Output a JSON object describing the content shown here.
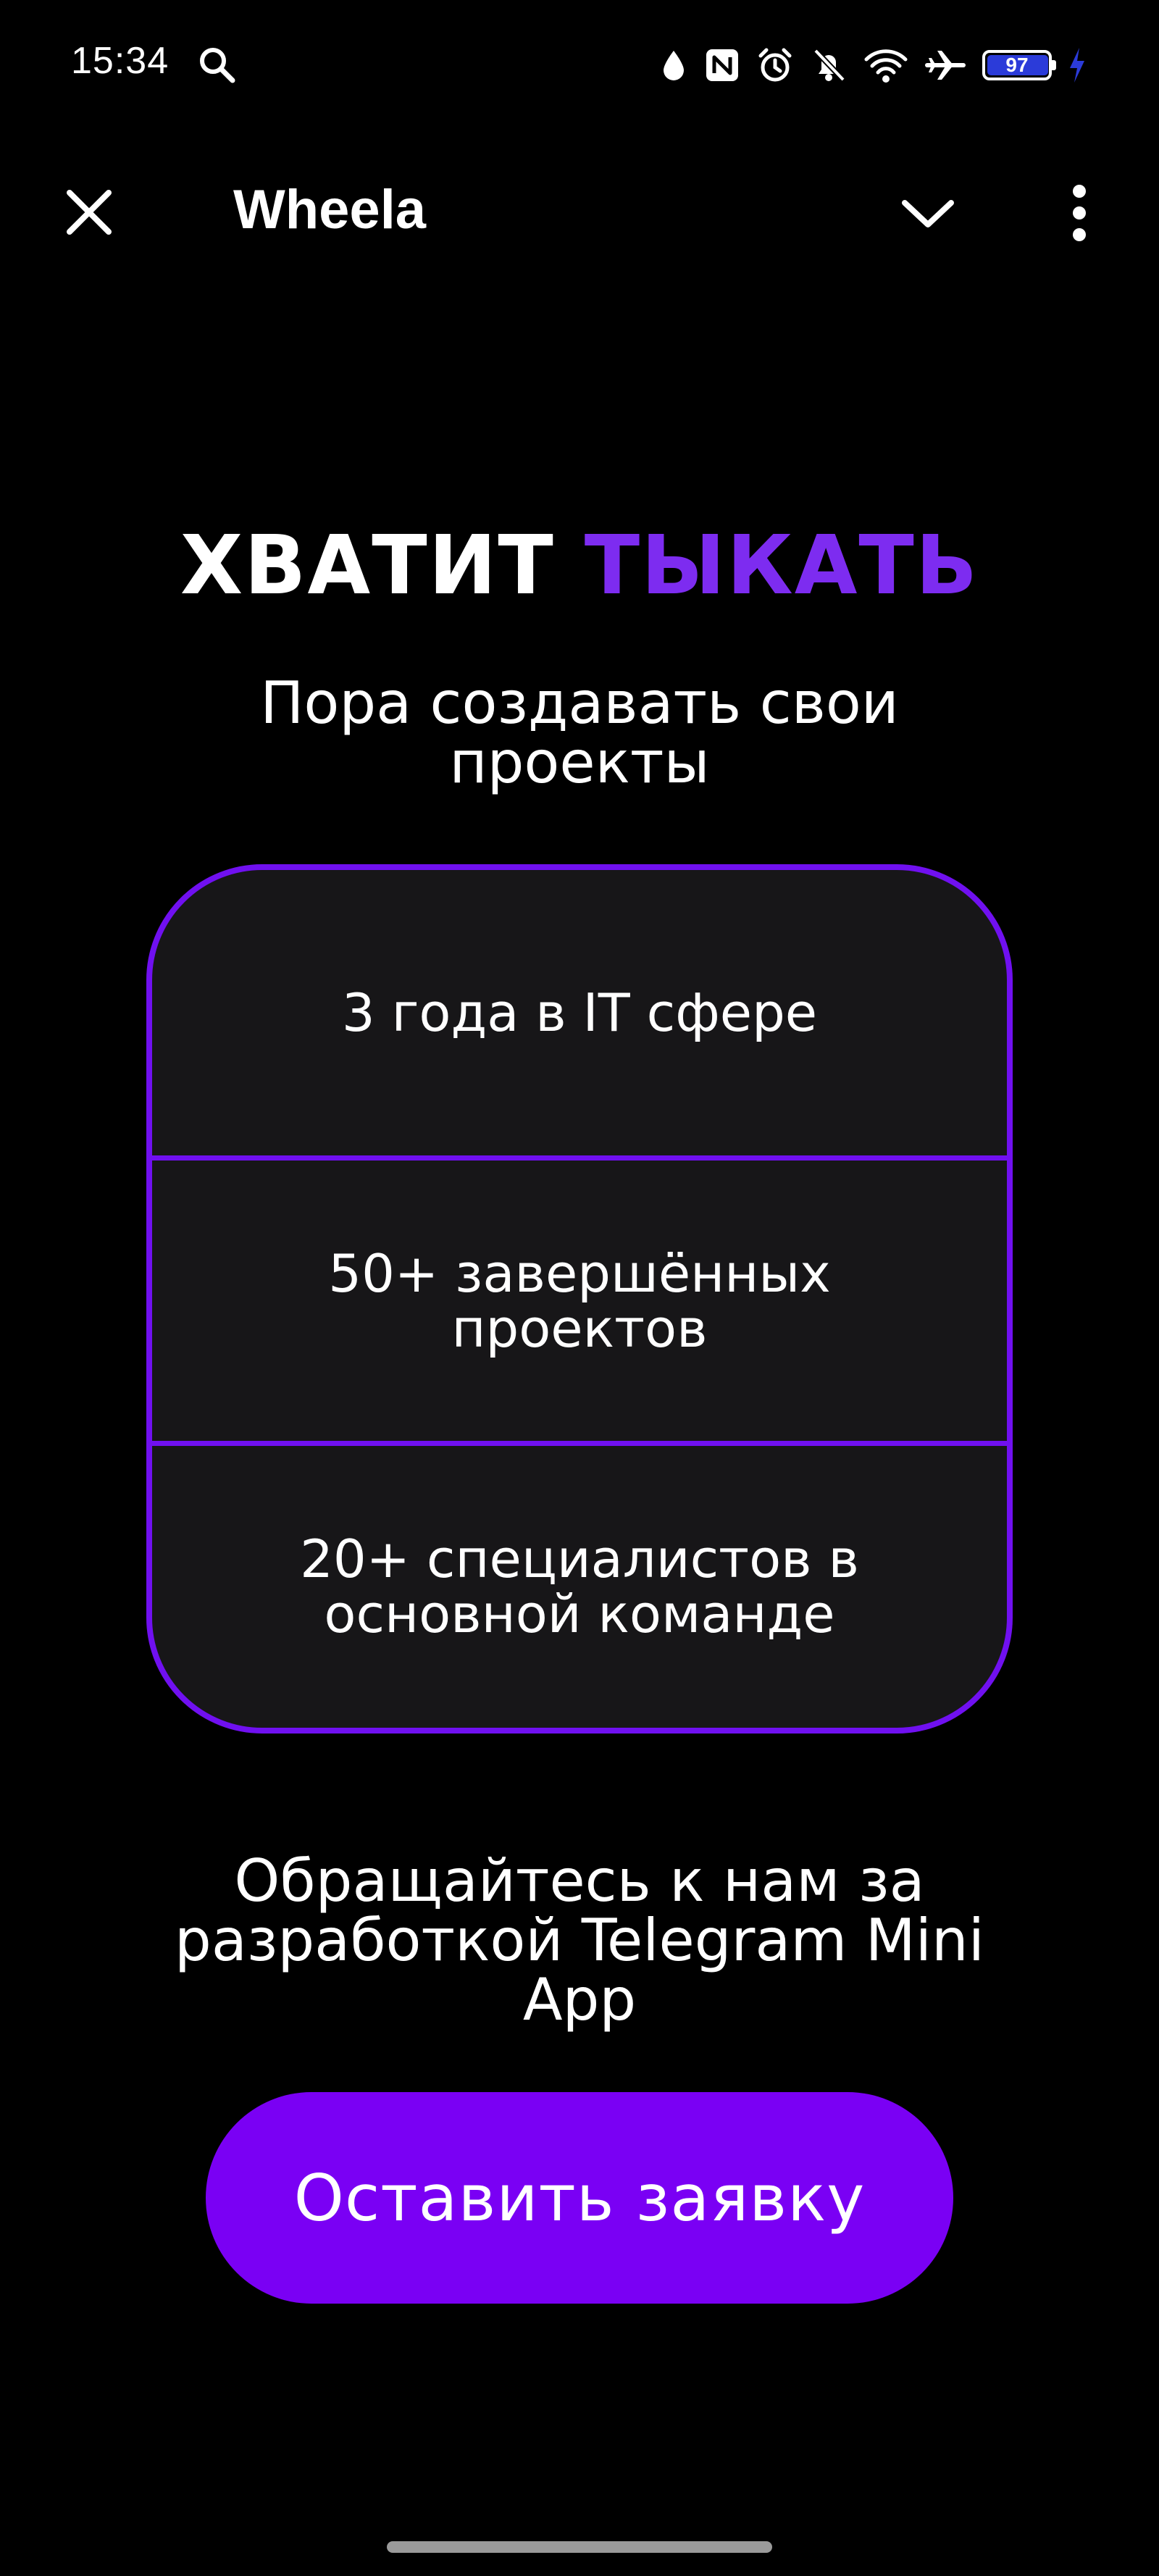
{
  "status_bar": {
    "time": "15:34",
    "battery_level": "97",
    "icons": [
      "search-icon",
      "drop-icon",
      "nfc-icon",
      "alarm-icon",
      "mute-icon",
      "wifi-icon",
      "airplane-icon",
      "battery-icon",
      "charging-icon"
    ]
  },
  "header": {
    "title": "Wheela",
    "close_icon": "close-icon",
    "collapse_icon": "chevron-down-icon",
    "menu_icon": "more-vertical-icon"
  },
  "hero": {
    "title_main": "ХВАТИТ",
    "title_accent": "ТЫКАТЬ",
    "subtitle": "Пора создавать свои проекты"
  },
  "stats": [
    {
      "text": "3 года в IT сфере"
    },
    {
      "text": "50+ завершённых проектов"
    },
    {
      "text": "20+ специалистов в основной команде"
    }
  ],
  "cta": {
    "text": "Обращайтесь к нам за разработкой Telegram Mini App",
    "button_label": "Оставить заявку"
  },
  "colors": {
    "background": "#000000",
    "accent": "#7a00f4",
    "card_border": "#7010f0",
    "card_background": "#171618",
    "text": "#ffffff"
  }
}
